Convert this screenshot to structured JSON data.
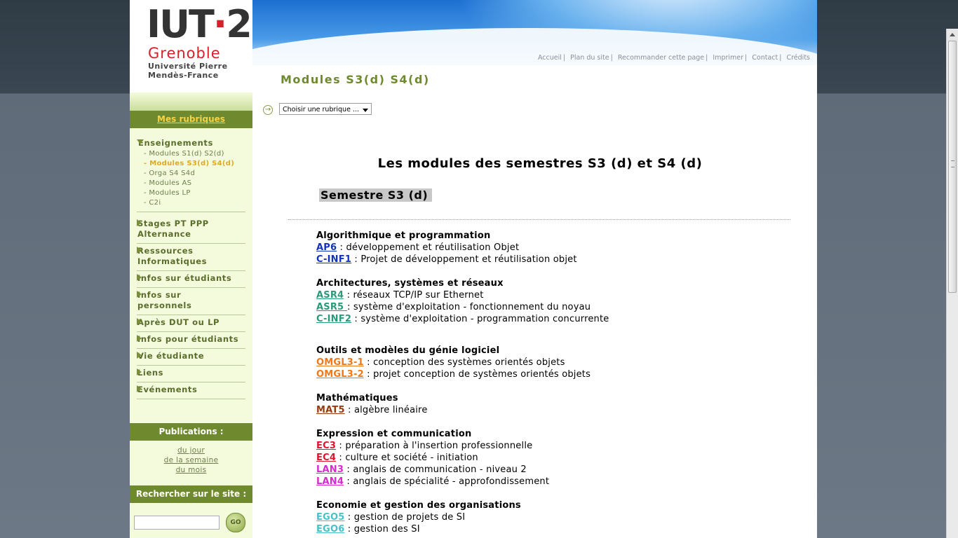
{
  "logo": {
    "iut": "IUT",
    "two": "2",
    "city": "Grenoble",
    "univ_line1": "Université Pierre",
    "univ_line2": "Mendès-France"
  },
  "top_links": [
    "Accueil",
    "Plan du site",
    "Recommander cette page",
    "Imprimer",
    "Contact",
    "Crédits"
  ],
  "page_title": "Modules S3(d) S4(d)",
  "rubrique_select": {
    "value": "Choisir une rubrique ..."
  },
  "sidebar": {
    "header": "Mes rubriques",
    "items": [
      {
        "label": "Enseignements",
        "sub": [
          "- Modules S1(d) S2(d)",
          "- Modules S3(d) S4(d)",
          "- Orga S4 S4d",
          "- Modules AS",
          "- Modules LP",
          "- C2i"
        ]
      },
      {
        "label1": "Stages PT PPP",
        "label2": "Alternance"
      },
      {
        "label1": "Ressources",
        "label2": "Informatiques"
      },
      {
        "label": "Infos sur étudiants"
      },
      {
        "label1": "Infos sur",
        "label2": "personnels"
      },
      {
        "label": "Après DUT ou LP"
      },
      {
        "label": "Infos pour étudiants"
      },
      {
        "label": "Vie étudiante"
      },
      {
        "label": "Liens"
      },
      {
        "label": "Evénements"
      }
    ],
    "publications": {
      "header": "Publications :",
      "links": [
        "du jour",
        "de la semaine",
        "du mois"
      ]
    },
    "search": {
      "header": "Rechercher sur le site :",
      "value": "",
      "button": "GO"
    }
  },
  "main": {
    "heading": "Les modules des semestres S3 (d) et S4 (d)",
    "semester": "Semestre S3 (d)",
    "categories": [
      {
        "title": "Algorithmique et programmation",
        "modules": [
          {
            "code": "AP6",
            "desc": " : développement et réutilisation Objet",
            "color": "#1233b8"
          },
          {
            "code": "C-INF1",
            "desc": " : Projet de développement et réutilisation objet",
            "color": "#1233b8"
          }
        ]
      },
      {
        "title": "Architectures, systèmes et réseaux",
        "modules": [
          {
            "code": "ASR4",
            "desc": " : réseaux TCP/IP sur Ethernet",
            "color": "#2a9a7a"
          },
          {
            "code": "ASR5 ",
            "desc": ": système d'exploitation - fonctionnement du noyau",
            "color": "#2a9a7a"
          },
          {
            "code": "C-INF2",
            "desc": " : système d'exploitation - programmation concurrente",
            "color": "#2a9a7a"
          }
        ]
      },
      {
        "title": "Outils et modèles du génie logiciel",
        "modules": [
          {
            "code": "OMGL3-1",
            "desc": " : conception des systèmes orientés objets",
            "color": "#f07818"
          },
          {
            "code": "OMGL3-2",
            "desc": " : projet conception de systèmes orientés objets",
            "color": "#f07818"
          }
        ]
      },
      {
        "title": "Mathématiques",
        "modules": [
          {
            "code": "MAT5",
            "desc": " : algèbre linéaire",
            "color": "#9a3a10"
          }
        ]
      },
      {
        "title": "Expression et communication",
        "modules": [
          {
            "code": "EC3",
            "desc": " : préparation à l'insertion professionnelle",
            "color": "#e0142c"
          },
          {
            "code": "EC4",
            "desc": " : culture et société - initiation",
            "color": "#e0142c"
          },
          {
            "code": "LAN3",
            "desc": " : anglais de communication - niveau 2",
            "color": "#d828d0"
          },
          {
            "code": "LAN4",
            "desc": " : anglais de spécialité - approfondissement",
            "color": "#d828d0"
          }
        ]
      },
      {
        "title": "Economie et gestion des organisations",
        "modules": [
          {
            "code": "EGO5",
            "desc": " : gestion de projets de SI",
            "color": "#48c0c8"
          },
          {
            "code": "EGO6",
            "desc": " : gestion des SI",
            "color": "#48c0c8"
          }
        ]
      }
    ]
  }
}
